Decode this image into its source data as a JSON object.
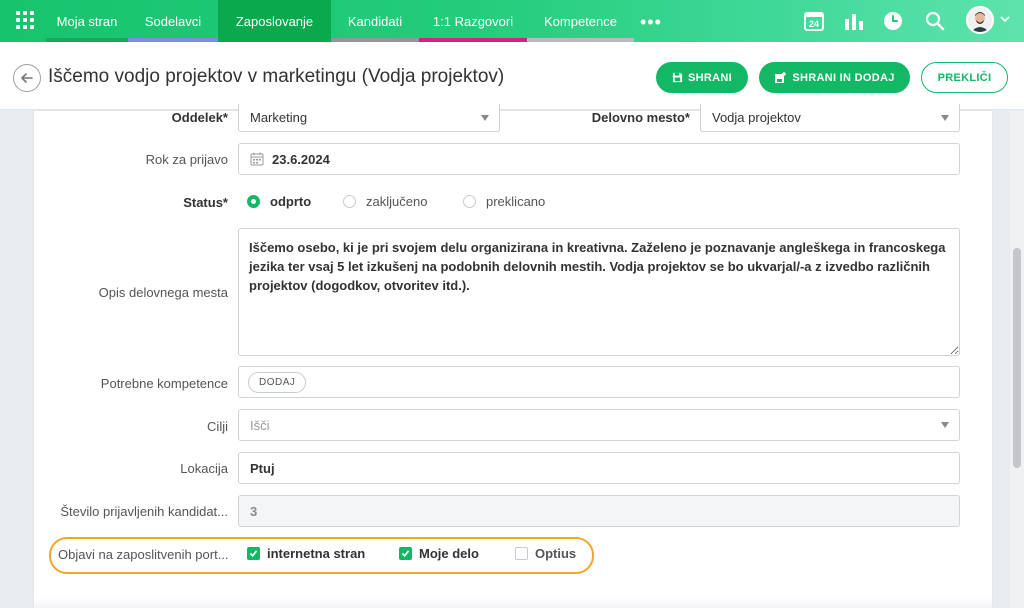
{
  "nav": {
    "tabs": [
      {
        "label": "Moja stran",
        "bar": "#1ba55f"
      },
      {
        "label": "Sodelavci",
        "bar": "#7a8de0"
      },
      {
        "label": "Zaposlovanje",
        "bar": "#0aa94e",
        "active": true
      },
      {
        "label": "Kandidati",
        "bar": "#8f979e"
      },
      {
        "label": "1:1 Razgovori",
        "bar": "#d81f8a"
      },
      {
        "label": "Kompetence",
        "bar": "#b6bcc2"
      }
    ],
    "more": "•••",
    "calendar_day": "24",
    "icons": [
      "apps-grid-icon",
      "calendar-icon",
      "bar-chart-icon",
      "clock-icon",
      "search-icon",
      "avatar",
      "chevron-down-icon"
    ],
    "colors": {
      "nav_start": "#18c36e",
      "nav_end": "#5ee3ad",
      "accent": "#12b864",
      "highlight": "#f5a623"
    }
  },
  "header": {
    "title": "Iščemo vodjo projektov v marketingu (Vodja projektov)",
    "save": "SHRANI",
    "save_add": "SHRANI IN DODAJ",
    "cancel": "PREKLIČI"
  },
  "form": {
    "department": {
      "label": "Oddelek*",
      "value": "Marketing"
    },
    "position": {
      "label": "Delovno mesto*",
      "value": "Vodja projektov"
    },
    "deadline": {
      "label": "Rok za prijavo",
      "value": "23.6.2024"
    },
    "status": {
      "label": "Status*",
      "options": [
        {
          "label": "odprto",
          "selected": true
        },
        {
          "label": "zaključeno",
          "selected": false
        },
        {
          "label": "preklicano",
          "selected": false
        }
      ]
    },
    "description": {
      "label": "Opis delovnega mesta",
      "value": "Iščemo osebo, ki je pri svojem delu organizirana in kreativna. Zaželeno je poznavanje angleškega in francoskega jezika ter vsaj 5 let izkušenj na podobnih delovnih mestih. Vodja projektov se bo ukvarjal/-a z izvedbo različnih projektov (dogodkov, otvoritev itd.)."
    },
    "competences": {
      "label": "Potrebne kompetence",
      "add": "DODAJ"
    },
    "goals": {
      "label": "Cilji",
      "placeholder": "Išči"
    },
    "location": {
      "label": "Lokacija",
      "value": "Ptuj"
    },
    "applicants": {
      "label": "Število prijavljenih kandidat...",
      "value": "3"
    },
    "publish": {
      "label": "Objavi na zaposlitvenih port...",
      "options": [
        {
          "label": "internetna stran",
          "checked": true
        },
        {
          "label": "Moje delo",
          "checked": true
        },
        {
          "label": "Optius",
          "checked": false
        }
      ]
    }
  }
}
